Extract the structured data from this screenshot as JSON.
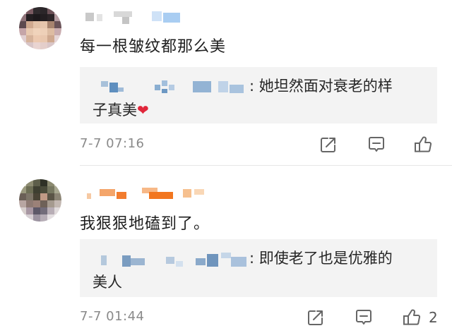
{
  "colors": {
    "like_heart": "#e0263a",
    "reply_bg": "#f3f3f3",
    "meta_text": "#8a8a8a"
  },
  "comments": [
    {
      "text": "每一根皱纹都那么美",
      "reply": {
        "text_line1": ": 她坦然面对衰老的样",
        "text_line2": "子真美"
      },
      "time": "7-7 07:16",
      "like_count": ""
    },
    {
      "text": "我狠狠地磕到了。",
      "reply": {
        "text_line1": ": 即使老了也是优雅的",
        "text_line2": "美人"
      },
      "time": "7-7 01:44",
      "like_count": "2"
    }
  ],
  "icons": {
    "share": "share-icon",
    "reply": "comment-icon",
    "like": "thumbs-up-icon",
    "heart": "heart-icon"
  }
}
